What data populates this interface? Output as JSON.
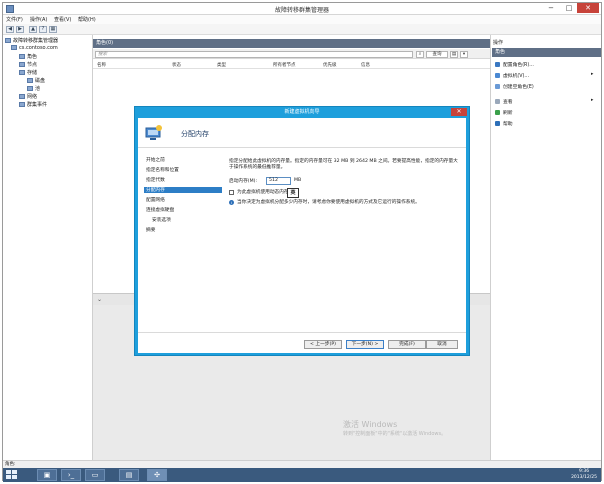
{
  "window": {
    "title": "故障转移群集管理器",
    "min": "−",
    "max": "□",
    "close": "✕"
  },
  "menu": [
    "文件(F)",
    "操作(A)",
    "查看(V)",
    "帮助(H)"
  ],
  "toolbar": {
    "back": "◀",
    "forward": "▶",
    "up": "▲",
    "help": "?",
    "view": "▦"
  },
  "tree": {
    "items": [
      {
        "label": "故障转移群集管理器",
        "icon": "cluster-manager-icon"
      },
      {
        "label": "cs.contoso.com",
        "icon": "cluster-icon"
      },
      {
        "label": "角色",
        "icon": "roles-icon"
      },
      {
        "label": "节点",
        "icon": "nodes-icon"
      },
      {
        "label": "存储",
        "icon": "storage-icon"
      },
      {
        "label": "磁盘",
        "icon": "disk-icon"
      },
      {
        "label": "池",
        "icon": "pool-icon"
      },
      {
        "label": "网络",
        "icon": "network-icon"
      },
      {
        "label": "群集事件",
        "icon": "events-icon"
      }
    ]
  },
  "center": {
    "header": "角色(0)",
    "search_placeholder": "搜索",
    "query_label": "查询",
    "columns": [
      "名称",
      "状态",
      "类型",
      "所有者节点",
      "优先级",
      "信息"
    ]
  },
  "actions": {
    "title": "操作",
    "section": "角色",
    "items": [
      {
        "label": "配置角色(R)...",
        "icon": "configure-role-icon",
        "color": "#3a78c2"
      },
      {
        "label": "虚拟机(V)...",
        "icon": "vm-icon",
        "color": "#4a88d2",
        "arrow": "▸"
      },
      {
        "label": "创建空角色(E)",
        "icon": "empty-role-icon",
        "color": "#6a9ad6"
      },
      {
        "label": "查看",
        "icon": "view-icon",
        "color": "#9aa8ba",
        "arrow": "▸"
      },
      {
        "label": "刷新",
        "icon": "refresh-icon",
        "color": "#3aa04a"
      },
      {
        "label": "帮助",
        "icon": "help-icon",
        "color": "#2d6fb8"
      }
    ]
  },
  "status": {
    "text": "角色: "
  },
  "taskbar": {
    "buttons": [
      "server-manager-icon",
      "powershell-icon",
      "explorer-icon",
      "hyper-v-icon",
      "cluster-manager-icon"
    ],
    "time": "9:36",
    "date": "2013/12/25"
  },
  "watermark": {
    "line1": "激活 Windows",
    "line2": "转到\"控制面板\"中的\"系统\"以激活 Windows。"
  },
  "dialog": {
    "title": "新建虚拟机向导",
    "heading": "分配内存",
    "steps": [
      {
        "label": "开始之前",
        "current": false,
        "sub": false
      },
      {
        "label": "指定名称和位置",
        "current": false,
        "sub": false
      },
      {
        "label": "指定代数",
        "current": false,
        "sub": false
      },
      {
        "label": "分配内存",
        "current": true,
        "sub": false
      },
      {
        "label": "配置网络",
        "current": false,
        "sub": false
      },
      {
        "label": "连接虚拟硬盘",
        "current": false,
        "sub": false
      },
      {
        "label": "安装选项",
        "current": false,
        "sub": true
      },
      {
        "label": "摘要",
        "current": false,
        "sub": false
      }
    ],
    "description": "指定分配给此虚拟机的内存量。指定的内存量可在 32 MB 到 2642 MB 之间。若要提高性能，指定的内存量大于操作系统的最低推荐量。",
    "memory_label": "启动内存(M):",
    "memory_value": "512",
    "memory_unit": "MB",
    "tooltip_char": "英",
    "dynamic_checkbox": "为此虚拟机使用动态内存(U)。",
    "dynamic_checked": false,
    "info": "当你决定为虚拟机分配多少内存时，请考虑你要使用虚拟机的方式及它运行的操作系统。",
    "buttons": {
      "prev": "< 上一步(P)",
      "next": "下一步(N) >",
      "finish": "完成(F)",
      "cancel": "取消"
    }
  }
}
